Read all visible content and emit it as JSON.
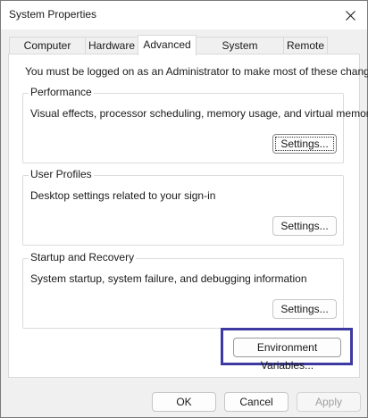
{
  "window": {
    "title": "System Properties",
    "close_icon": "close-icon"
  },
  "tabs": [
    {
      "label": "Computer Name",
      "active": false
    },
    {
      "label": "Hardware",
      "active": false
    },
    {
      "label": "Advanced",
      "active": true
    },
    {
      "label": "System Protection",
      "active": false
    },
    {
      "label": "Remote",
      "active": false
    }
  ],
  "panel": {
    "admin_note": "You must be logged on as an Administrator to make most of these changes.",
    "groups": [
      {
        "title": "Performance",
        "description": "Visual effects, processor scheduling, memory usage, and virtual memory",
        "button_label": "Settings..."
      },
      {
        "title": "User Profiles",
        "description": "Desktop settings related to your sign-in",
        "button_label": "Settings..."
      },
      {
        "title": "Startup and Recovery",
        "description": "System startup, system failure, and debugging information",
        "button_label": "Settings..."
      }
    ],
    "env_vars_label": "Environment Variables...",
    "highlight_color": "#3d3aa1"
  },
  "footer": {
    "ok_label": "OK",
    "cancel_label": "Cancel",
    "apply_label": "Apply",
    "apply_enabled": false
  }
}
